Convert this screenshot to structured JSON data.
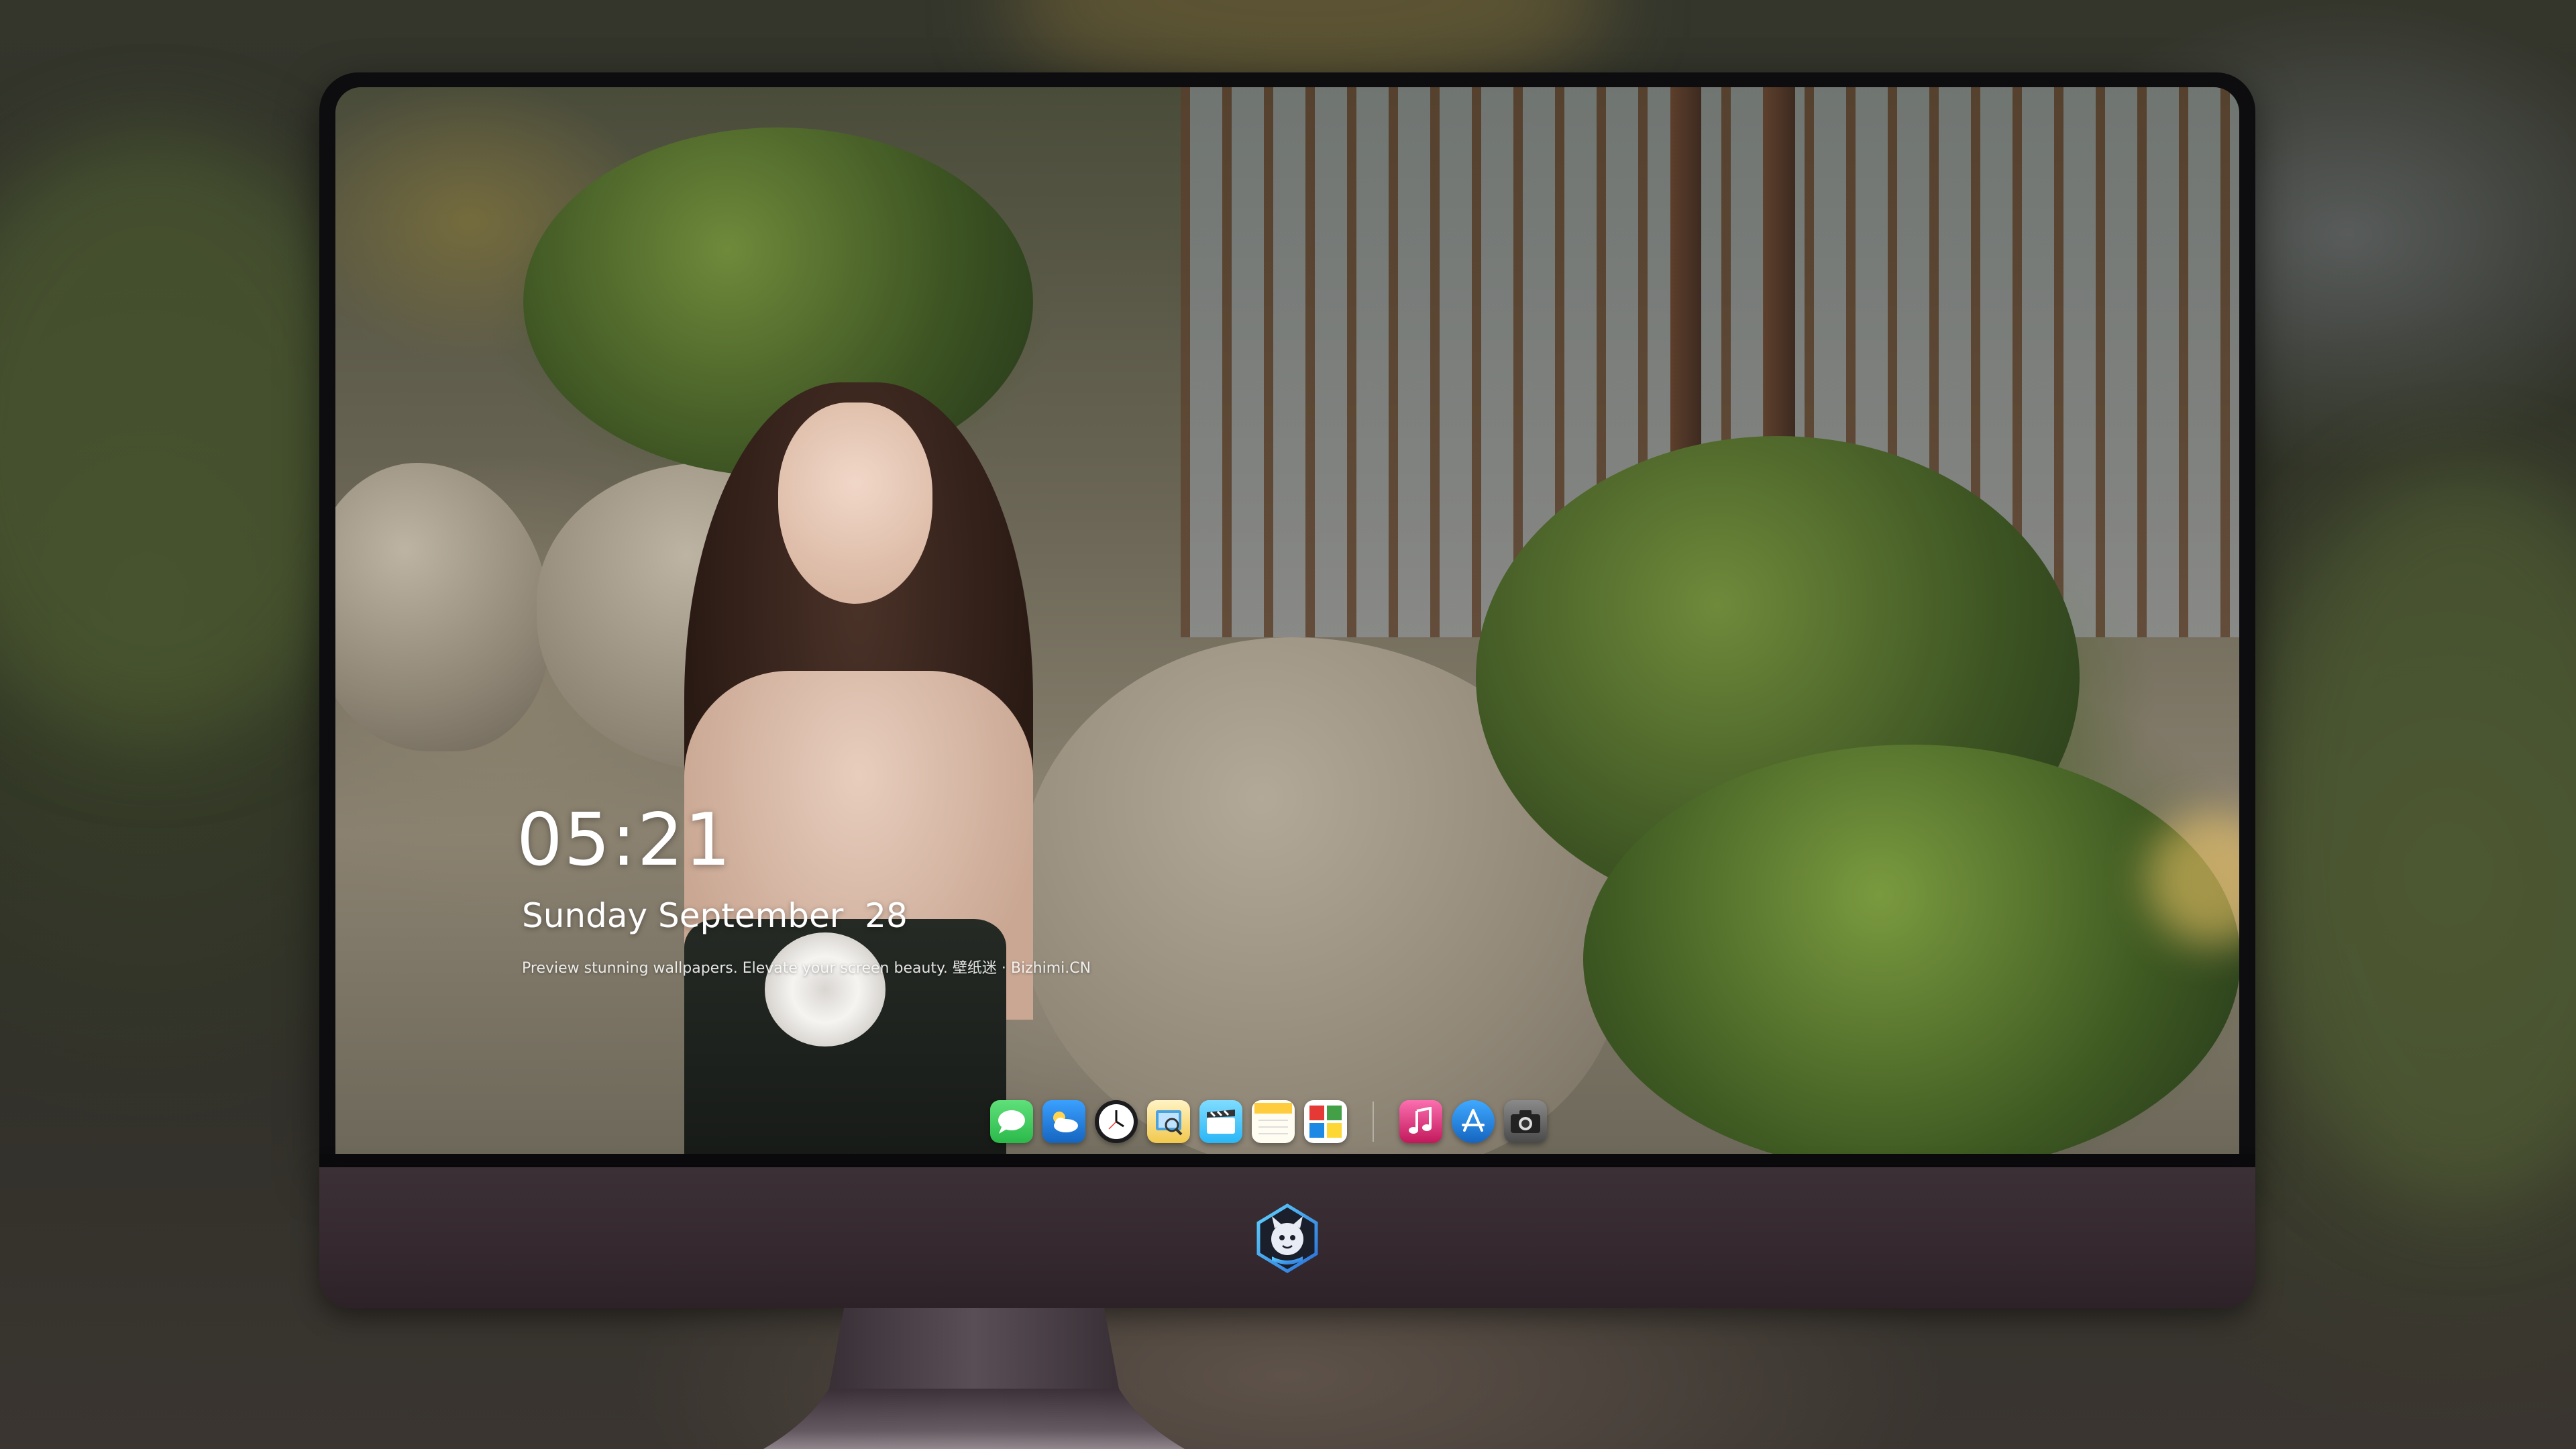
{
  "lock_screen": {
    "time": "05:21",
    "date": "Sunday September  28",
    "tagline": "Preview stunning wallpapers. Elevate your screen beauty. 壁纸迷 · Bizhimi.CN"
  },
  "dock": {
    "apps": [
      {
        "name": "messages-icon",
        "color": "#34c759"
      },
      {
        "name": "weather-icon",
        "color": "#1f8cf0"
      },
      {
        "name": "clock-icon",
        "color": "#1c1c1e"
      },
      {
        "name": "preview-icon",
        "color": "#f2c94c"
      },
      {
        "name": "clips-icon",
        "color": "#4fc3f7"
      },
      {
        "name": "notes-icon",
        "color": "#ffd54f"
      },
      {
        "name": "photo-booth-icon",
        "color": "#e53935"
      },
      {
        "name": "music-icon",
        "color": "#f06292"
      },
      {
        "name": "app-store-icon",
        "color": "#1e88e5"
      },
      {
        "name": "camera-icon",
        "color": "#616161"
      }
    ]
  },
  "monitor": {
    "logo": "mascot-logo-icon",
    "chin_color": "#35292f"
  }
}
